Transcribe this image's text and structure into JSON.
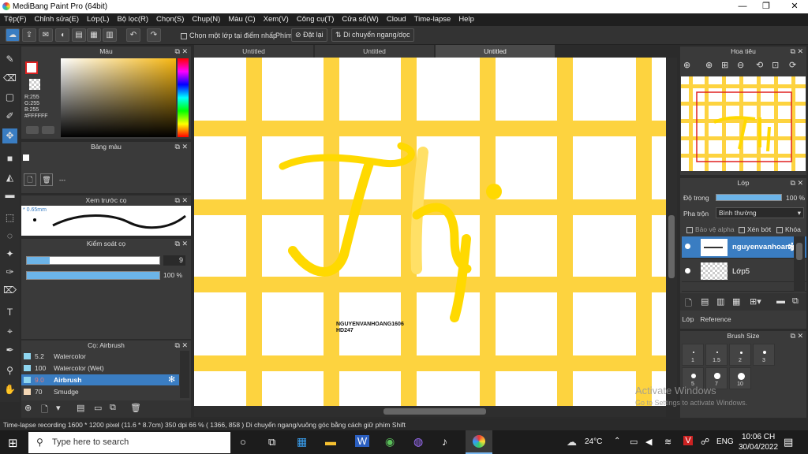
{
  "window": {
    "title": "MediBang Paint Pro (64bit)",
    "minimize": "—",
    "maximize": "❐",
    "close": "✕"
  },
  "menu": [
    "Tệp(F)",
    "Chỉnh sửa(E)",
    "Lớp(L)",
    "Bộ lọc(R)",
    "Chọn(S)",
    "Chụp(N)",
    "Màu (C)",
    "Xem(V)",
    "Công cụ(T)",
    "Cửa sổ(W)",
    "Cloud",
    "Time-lapse",
    "Help"
  ],
  "toolbar": {
    "select_layer_label": "Chọn một lớp tại điểm nhấp",
    "key_label": "Phím",
    "reset_label": "Đặt lại",
    "move_label": "Di chuyển ngang/dọc"
  },
  "color_panel": {
    "title": "Màu",
    "r": "R:255",
    "g": "G:255",
    "b": "B:255",
    "hex": "#FFFFFF"
  },
  "palette_panel": {
    "title": "Bảng màu",
    "dash": "---"
  },
  "brush_preview": {
    "title": "Xem trước cọ",
    "size": "0.65mm"
  },
  "brush_control": {
    "title": "Kiểm soát cọ",
    "size_value": "9",
    "opacity_value": "100 %",
    "size_fraction": 0.17,
    "opacity_fraction": 1.0
  },
  "brush_panel": {
    "title": "Cọ: Airbrush",
    "items": [
      {
        "size": "5.2",
        "name": "Watercolor",
        "color": "#8fd6f0",
        "active": false
      },
      {
        "size": "100",
        "name": "Watercolor (Wet)",
        "color": "#8fd6f0",
        "active": false
      },
      {
        "size": "9.0",
        "name": "Airbrush",
        "color": "#8fd6f0",
        "active": true
      },
      {
        "size": "70",
        "name": "Smudge",
        "color": "#f4d7b5",
        "active": false
      }
    ]
  },
  "tabs": [
    "Untitled",
    "Untitled",
    "Untitled"
  ],
  "canvas": {
    "signature_line1": "NGUYENVANHOANG1606",
    "signature_line2": "HD247"
  },
  "navigator": {
    "title": "Hoa tiêu"
  },
  "layer_panel": {
    "title": "Lớp",
    "opacity_label": "Độ trong",
    "opacity_value": "100 %",
    "opacity_fraction": 1.0,
    "blend_label": "Pha trộn",
    "blend_value": "Bình thường",
    "alpha_label": "Bảo vệ alpha",
    "clip_label": "Xén bớt",
    "lock_label": "Khóa",
    "layers": [
      {
        "name": "nguyenvanhoang",
        "active": true
      },
      {
        "name": "Lớp5",
        "active": false
      }
    ],
    "tab_layer": "Lớp",
    "tab_reference": "Reference"
  },
  "brush_size_panel": {
    "title": "Brush Size",
    "sizes": [
      "1",
      "1.5",
      "2",
      "3",
      "5",
      "7",
      "10"
    ]
  },
  "statusbar": {
    "text": "Time-lapse recording  1600 * 1200 pixel  (11.6 * 8.7cm)  350 dpi  66 %  ( 1366, 858 )  Di chuyển ngang/vuông góc bằng cách giữ phím Shift"
  },
  "watermark": {
    "line1": "Activate Windows",
    "line2": "Go to Settings to activate Windows."
  },
  "taskbar": {
    "search_placeholder": "Type here to search",
    "weather": "24°C",
    "lang": "ENG",
    "time": "10:06 CH",
    "date": "30/04/2022"
  },
  "colors": {
    "accent": "#3a7dc2",
    "grid_yellow": "#fdd33f",
    "text_yellow": "#ffe400"
  }
}
